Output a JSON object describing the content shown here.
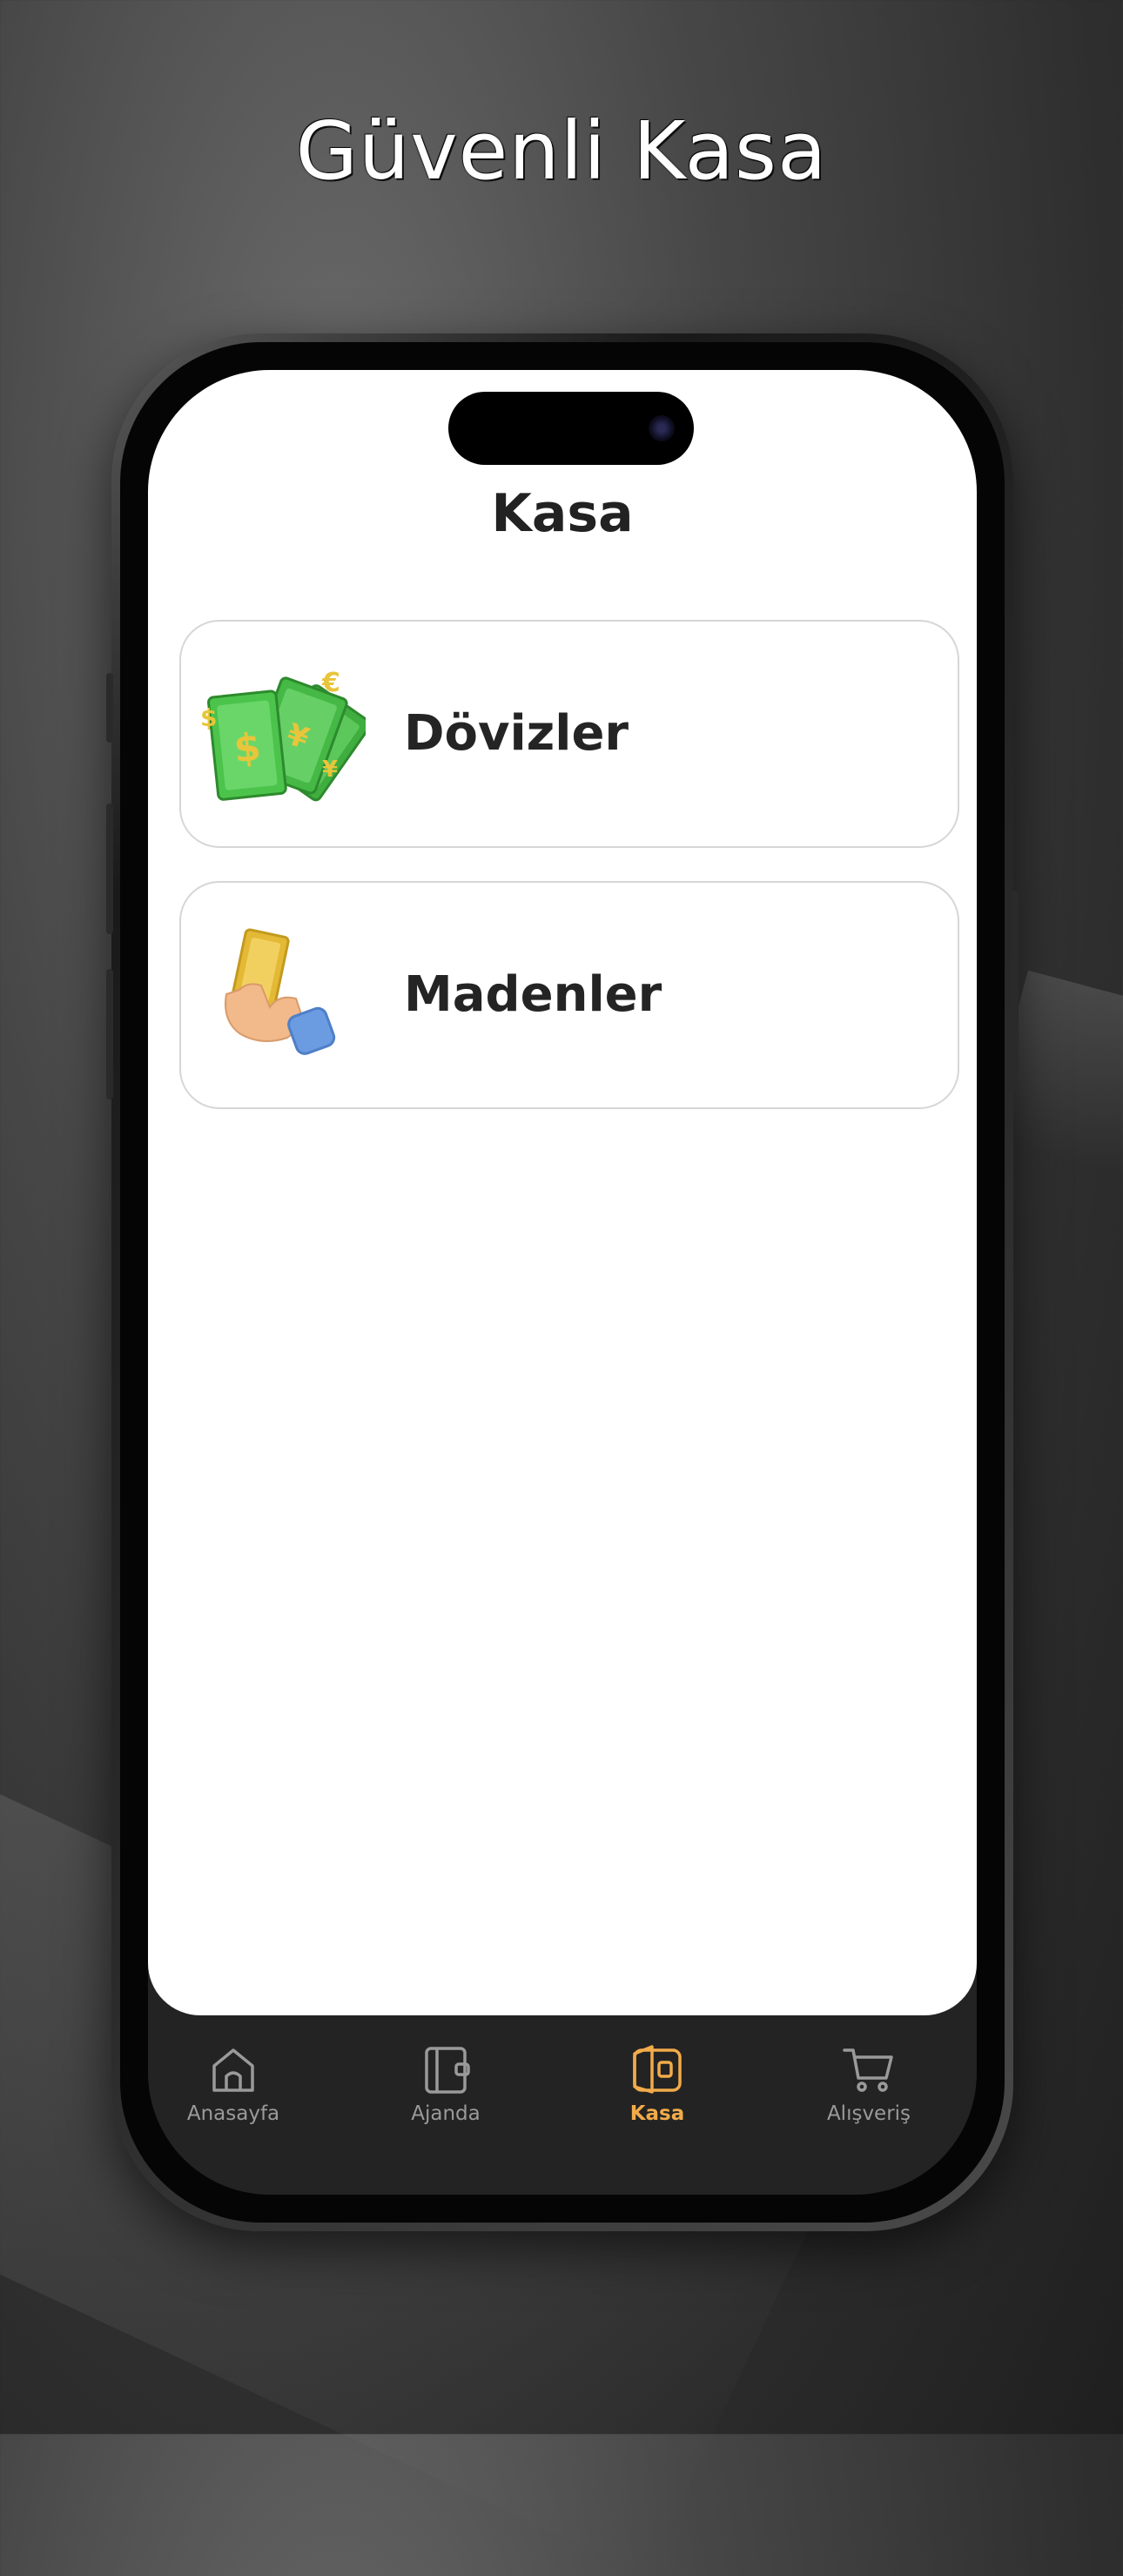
{
  "promo": {
    "title": "Güvenli Kasa"
  },
  "screen": {
    "title": "Kasa"
  },
  "cards": [
    {
      "label": "Dövizler",
      "icon": "money-bills-icon"
    },
    {
      "label": "Madenler",
      "icon": "gold-bar-hand-icon"
    }
  ],
  "tabbar": {
    "active": "Kasa",
    "active_color": "#f2ab4a",
    "items": [
      {
        "label": "Anasayfa",
        "icon": "home-icon"
      },
      {
        "label": "Ajanda",
        "icon": "wallet-icon"
      },
      {
        "label": "Kasa",
        "icon": "safe-icon"
      },
      {
        "label": "Alışveriş",
        "icon": "cart-icon"
      }
    ]
  }
}
